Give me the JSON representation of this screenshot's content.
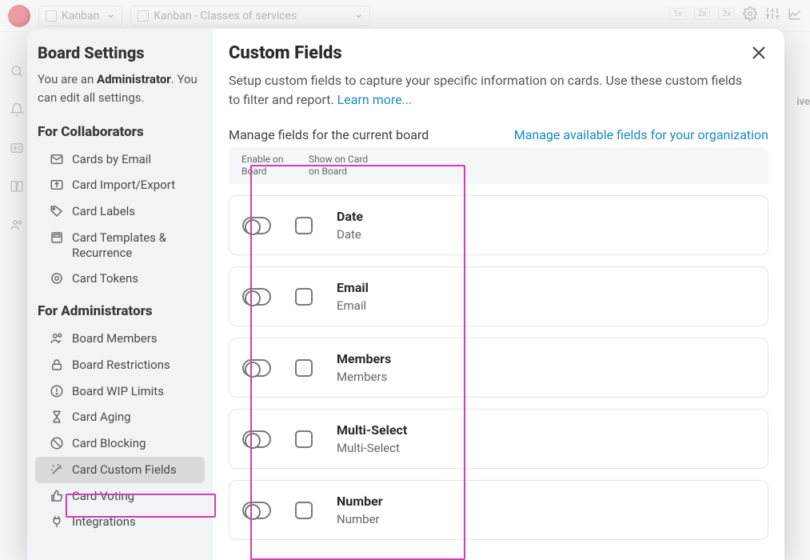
{
  "backdrop": {
    "select1": "Kanban",
    "select2": "Kanban - Classes of services",
    "zoom": [
      "1x",
      "2x",
      "3x"
    ],
    "archive_label": "ive"
  },
  "sidebar": {
    "title": "Board Settings",
    "admin_line_prefix": "You are an ",
    "admin_word": "Administrator",
    "admin_line_suffix": ". You can edit all settings.",
    "section_collab": "For Collaborators",
    "section_admin": "For Administrators",
    "items_collab": [
      {
        "label": "Cards by Email"
      },
      {
        "label": "Card Import/Export"
      },
      {
        "label": "Card Labels"
      },
      {
        "label": "Card Templates & Recurrence"
      },
      {
        "label": "Card Tokens"
      }
    ],
    "items_admin": [
      {
        "label": "Board Members"
      },
      {
        "label": "Board Restrictions"
      },
      {
        "label": "Board WIP Limits"
      },
      {
        "label": "Card Aging"
      },
      {
        "label": "Card Blocking"
      },
      {
        "label": "Card Custom Fields"
      },
      {
        "label": "Card Voting"
      },
      {
        "label": "Integrations"
      }
    ]
  },
  "main": {
    "title": "Custom Fields",
    "description": "Setup custom fields to capture your specific information on cards. Use these custom fields to filter and report. ",
    "learn_more": "Learn more...",
    "manage_current": "Manage fields for the current board",
    "manage_org": "Manage available fields for your organization",
    "col_enable": "Enable on Board",
    "col_show": "Show on Card on Board",
    "fields": [
      {
        "name": "Date",
        "type": "Date"
      },
      {
        "name": "Email",
        "type": "Email"
      },
      {
        "name": "Members",
        "type": "Members"
      },
      {
        "name": "Multi-Select",
        "type": "Multi-Select"
      },
      {
        "name": "Number",
        "type": "Number"
      }
    ]
  }
}
